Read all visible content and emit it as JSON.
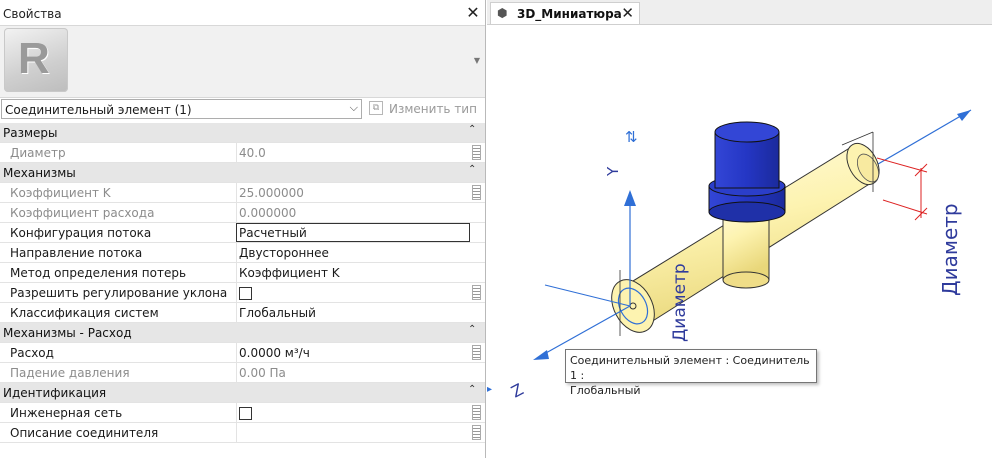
{
  "panel": {
    "title": "Свойства",
    "close_glyph": "✕",
    "logo_letter": "R",
    "type_dropdown_glyph": "▼",
    "selector_value": "Соединительный элемент (1)",
    "selector_chevron": "⌵",
    "edit_type_label": "Изменить тип",
    "collapse_glyph": "⌃"
  },
  "groups": {
    "sizes": "Размеры",
    "mech": "Механизмы",
    "mech_flow": "Механизмы - Расход",
    "ident": "Идентификация"
  },
  "rows": {
    "diameter": {
      "label": "Диаметр",
      "value": "40.0"
    },
    "k_coef": {
      "label": "Коэффициент K",
      "value": "25.000000"
    },
    "flow_coef": {
      "label": "Коэффициент расхода",
      "value": "0.000000"
    },
    "flow_config": {
      "label": "Конфигурация потока",
      "value": "Расчетный"
    },
    "flow_dir": {
      "label": "Направление потока",
      "value": "Двустороннее"
    },
    "loss_method": {
      "label": "Метод определения потерь",
      "value": "Коэффициент K"
    },
    "allow_slope": {
      "label": "Разрешить регулирование уклона"
    },
    "system_class": {
      "label": "Классификация систем",
      "value": "Глобальный"
    },
    "flow": {
      "label": "Расход",
      "value": "0.0000 м³/ч"
    },
    "pressure_drop": {
      "label": "Падение давления",
      "value": "0.00 Па"
    },
    "network": {
      "label": "Инженерная сеть"
    },
    "connector_desc": {
      "label": "Описание соединителя",
      "value": ""
    }
  },
  "view": {
    "tab_label": "3D_Миниатюра",
    "tab_close": "✕",
    "axis_y": "Y",
    "axis_z": "Z",
    "dim_label_right": "Диаметр",
    "dim_label_left": "Диаметр",
    "tooltip_line1": "Соединительный элемент : Соединитель 1 :",
    "tooltip_line2": "Глобальный",
    "colors": {
      "pipe": "#fdf3b0",
      "cap": "#2b3ec9",
      "axis": "#2f6fd6",
      "dimension": "#d22"
    }
  }
}
